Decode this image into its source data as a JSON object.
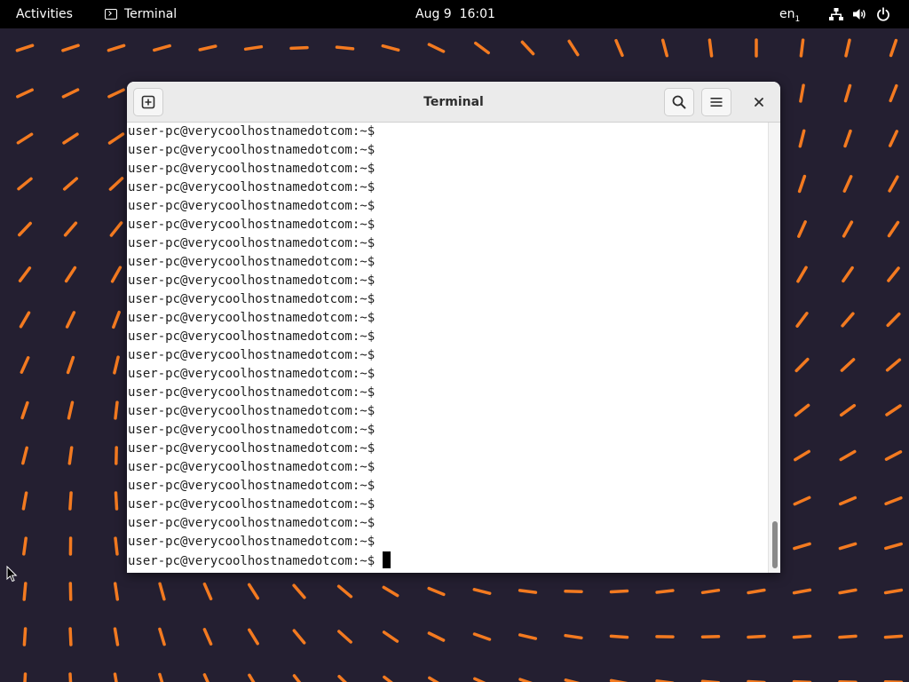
{
  "topbar": {
    "activities_label": "Activities",
    "app_name": "Terminal",
    "app_icon": "terminal-icon",
    "clock": "Aug 9  16:01",
    "input_source": "en",
    "input_source_sub": "1",
    "status_icons": [
      "network-icon",
      "volume-icon",
      "power-icon"
    ]
  },
  "terminal": {
    "title": "Terminal",
    "buttons": {
      "new_tab": "new-tab-icon",
      "search": "search-icon",
      "menu": "hamburger-menu-icon",
      "close": "close-icon"
    },
    "prompt": "user-pc@verycoolhostnamedotcom:~$",
    "lines": [
      "user-pc@verycoolhostnamedotcom:~$",
      "user-pc@verycoolhostnamedotcom:~$",
      "user-pc@verycoolhostnamedotcom:~$",
      "user-pc@verycoolhostnamedotcom:~$",
      "user-pc@verycoolhostnamedotcom:~$",
      "user-pc@verycoolhostnamedotcom:~$",
      "user-pc@verycoolhostnamedotcom:~$",
      "user-pc@verycoolhostnamedotcom:~$",
      "user-pc@verycoolhostnamedotcom:~$",
      "user-pc@verycoolhostnamedotcom:~$",
      "user-pc@verycoolhostnamedotcom:~$",
      "user-pc@verycoolhostnamedotcom:~$",
      "user-pc@verycoolhostnamedotcom:~$",
      "user-pc@verycoolhostnamedotcom:~$",
      "user-pc@verycoolhostnamedotcom:~$",
      "user-pc@verycoolhostnamedotcom:~$",
      "user-pc@verycoolhostnamedotcom:~$",
      "user-pc@verycoolhostnamedotcom:~$",
      "user-pc@verycoolhostnamedotcom:~$",
      "user-pc@verycoolhostnamedotcom:~$",
      "user-pc@verycoolhostnamedotcom:~$",
      "user-pc@verycoolhostnamedotcom:~$",
      "user-pc@verycoolhostnamedotcom:~$",
      "user-pc@verycoolhostnamedotcom:~$ "
    ]
  },
  "colors": {
    "desktop_background": "#241f31",
    "wallpaper_stroke": "#f37a20",
    "topbar_background": "#000000",
    "terminal_background": "#ffffff",
    "headerbar_background": "#ebebeb"
  }
}
